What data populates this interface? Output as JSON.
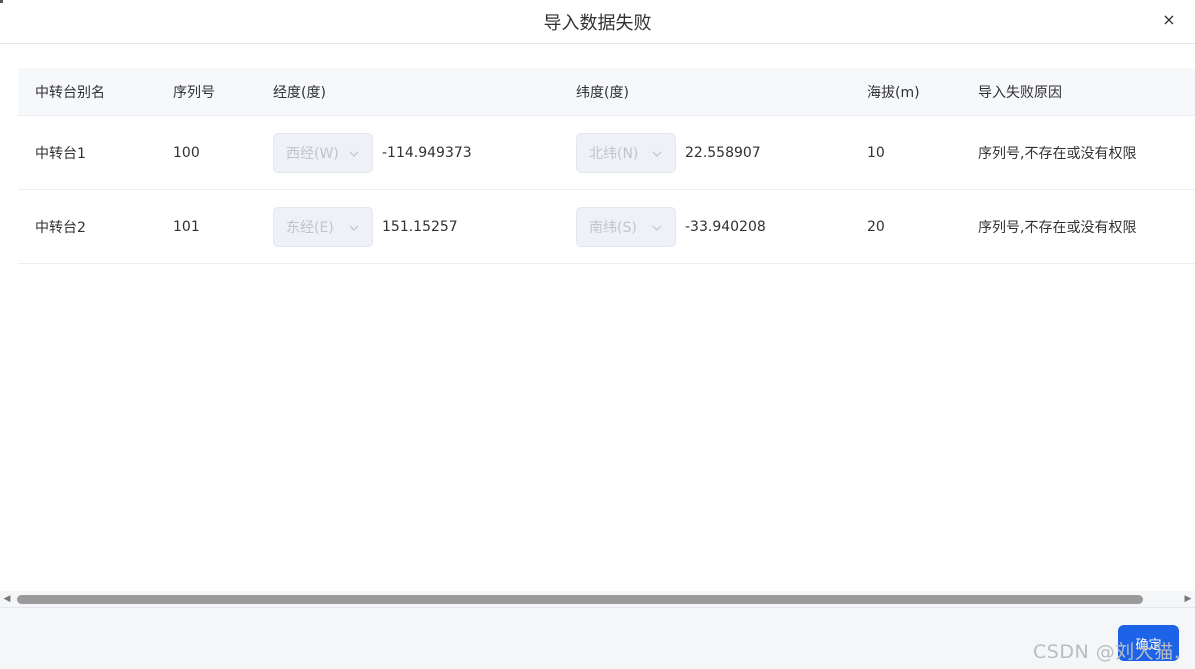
{
  "dialog": {
    "title": "导入数据失败",
    "close_icon": "×"
  },
  "table": {
    "headers": [
      "中转台别名",
      "序列号",
      "经度(度)",
      "纬度(度)",
      "海拔(m)",
      "导入失败原因"
    ],
    "rows": [
      {
        "alias": "中转台1",
        "serial": "100",
        "lng_dir": "西经(W)",
        "lng": "-114.949373",
        "lat_dir": "北纬(N)",
        "lat": "22.558907",
        "altitude": "10",
        "reason": "序列号,不存在或没有权限"
      },
      {
        "alias": "中转台2",
        "serial": "101",
        "lng_dir": "东经(E)",
        "lng": "151.15257",
        "lat_dir": "南纬(S)",
        "lat": "-33.940208",
        "altitude": "20",
        "reason": "序列号,不存在或没有权限"
      }
    ]
  },
  "scrollbar": {
    "left_icon": "◀",
    "right_icon": "▶"
  },
  "footer": {
    "confirm_label": "确定",
    "watermark": "CSDN @刘大猫."
  },
  "colors": {
    "accent": "#1d63e8",
    "header_bg": "#f7f8fa",
    "select_bg": "#eef1f7"
  }
}
